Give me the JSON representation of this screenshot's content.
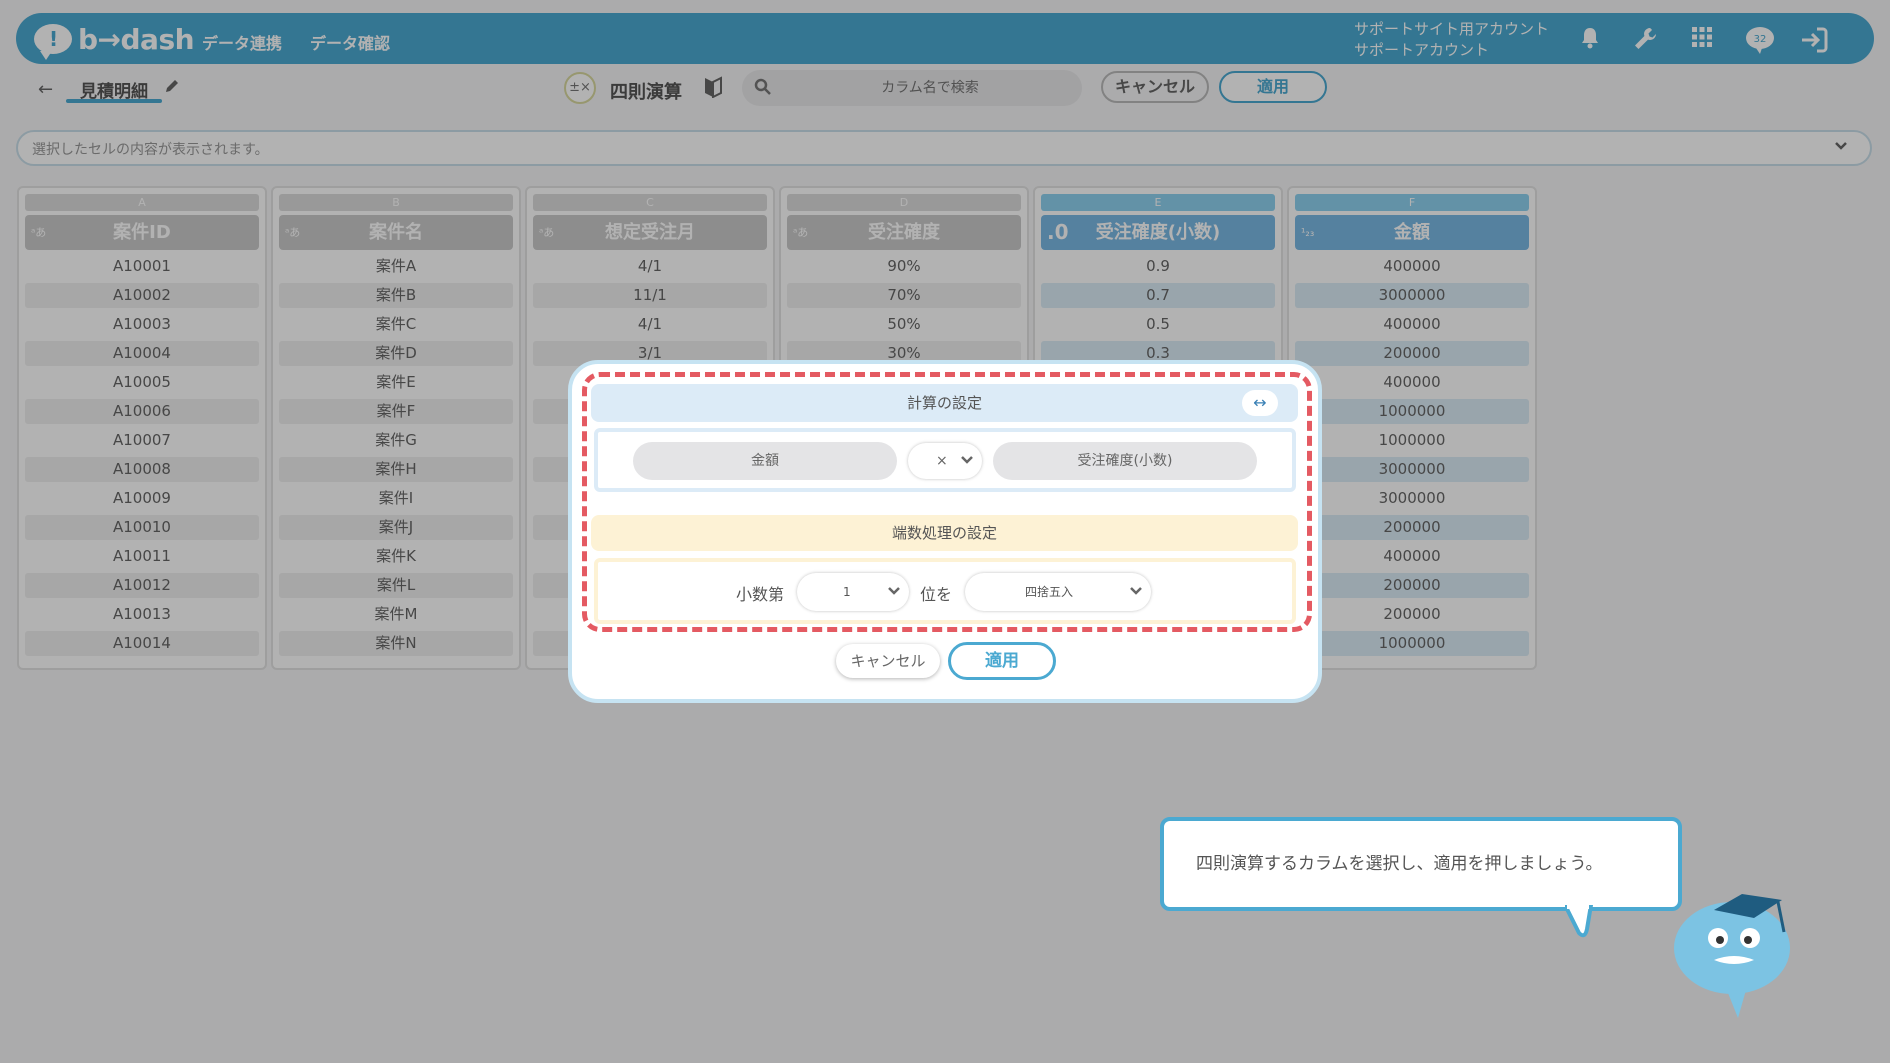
{
  "header": {
    "logo": "b→dash",
    "nav": [
      "データ連携",
      "データ確認"
    ],
    "account": [
      "サポートサイト用アカウント",
      "サポートアカウント"
    ],
    "badge": "32"
  },
  "toolbar": {
    "back_glyph": "←",
    "sheet_name": "見積明細",
    "operation_title": "四則演算",
    "search_placeholder": "カラム名で検索",
    "cancel_label": "キャンセル",
    "apply_label": "適用"
  },
  "cellbar": {
    "placeholder": "選択したセルの内容が表示されます。"
  },
  "table": {
    "columns": [
      {
        "letter": "A",
        "type_icon": "ᵃあ",
        "name": "案件ID",
        "highlight": false,
        "values": [
          "A10001",
          "A10002",
          "A10003",
          "A10004",
          "A10005",
          "A10006",
          "A10007",
          "A10008",
          "A10009",
          "A10010",
          "A10011",
          "A10012",
          "A10013",
          "A10014"
        ]
      },
      {
        "letter": "B",
        "type_icon": "ᵃあ",
        "name": "案件名",
        "highlight": false,
        "values": [
          "案件A",
          "案件B",
          "案件C",
          "案件D",
          "案件E",
          "案件F",
          "案件G",
          "案件H",
          "案件I",
          "案件J",
          "案件K",
          "案件L",
          "案件M",
          "案件N"
        ]
      },
      {
        "letter": "C",
        "type_icon": "ᵃあ",
        "name": "想定受注月",
        "highlight": false,
        "values": [
          "4/1",
          "11/1",
          "4/1",
          "3/1",
          "",
          "",
          "",
          "",
          "",
          "",
          "",
          "",
          "",
          ""
        ]
      },
      {
        "letter": "D",
        "type_icon": "ᵃあ",
        "name": "受注確度",
        "highlight": false,
        "values": [
          "90%",
          "70%",
          "50%",
          "30%",
          "",
          "",
          "",
          "",
          "",
          "",
          "",
          "",
          "",
          ""
        ]
      },
      {
        "letter": "E",
        "type_icon": ".0",
        "name": "受注確度(小数)",
        "highlight": true,
        "values": [
          "0.9",
          "0.7",
          "0.5",
          "0.3",
          "",
          "",
          "",
          "",
          "",
          "",
          "",
          "",
          "",
          ""
        ]
      },
      {
        "letter": "F",
        "type_icon": "¹₂₃",
        "name": "金額",
        "highlight": true,
        "values": [
          "400000",
          "3000000",
          "400000",
          "200000",
          "400000",
          "1000000",
          "1000000",
          "3000000",
          "3000000",
          "200000",
          "400000",
          "200000",
          "200000",
          "1000000"
        ]
      }
    ]
  },
  "modal": {
    "calc_heading": "計算の設定",
    "swap_glyph": "↔",
    "left_column": "金額",
    "operator": "×",
    "right_column": "受注確度(小数)",
    "rounding_heading": "端数処理の設定",
    "decimal_label": "小数第",
    "digit_value": "1",
    "position_label": "位を",
    "rounding_mode": "四捨五入",
    "cancel_label": "キャンセル",
    "apply_label": "適用"
  },
  "tip": {
    "text": "四則演算するカラムを選択し、適用を押しましょう。"
  },
  "colors": {
    "brand": "#4ba9d1",
    "highlight_dash": "#e45a62",
    "calc_section": "#dcebf7",
    "rounding_section": "#fdf2d5"
  }
}
